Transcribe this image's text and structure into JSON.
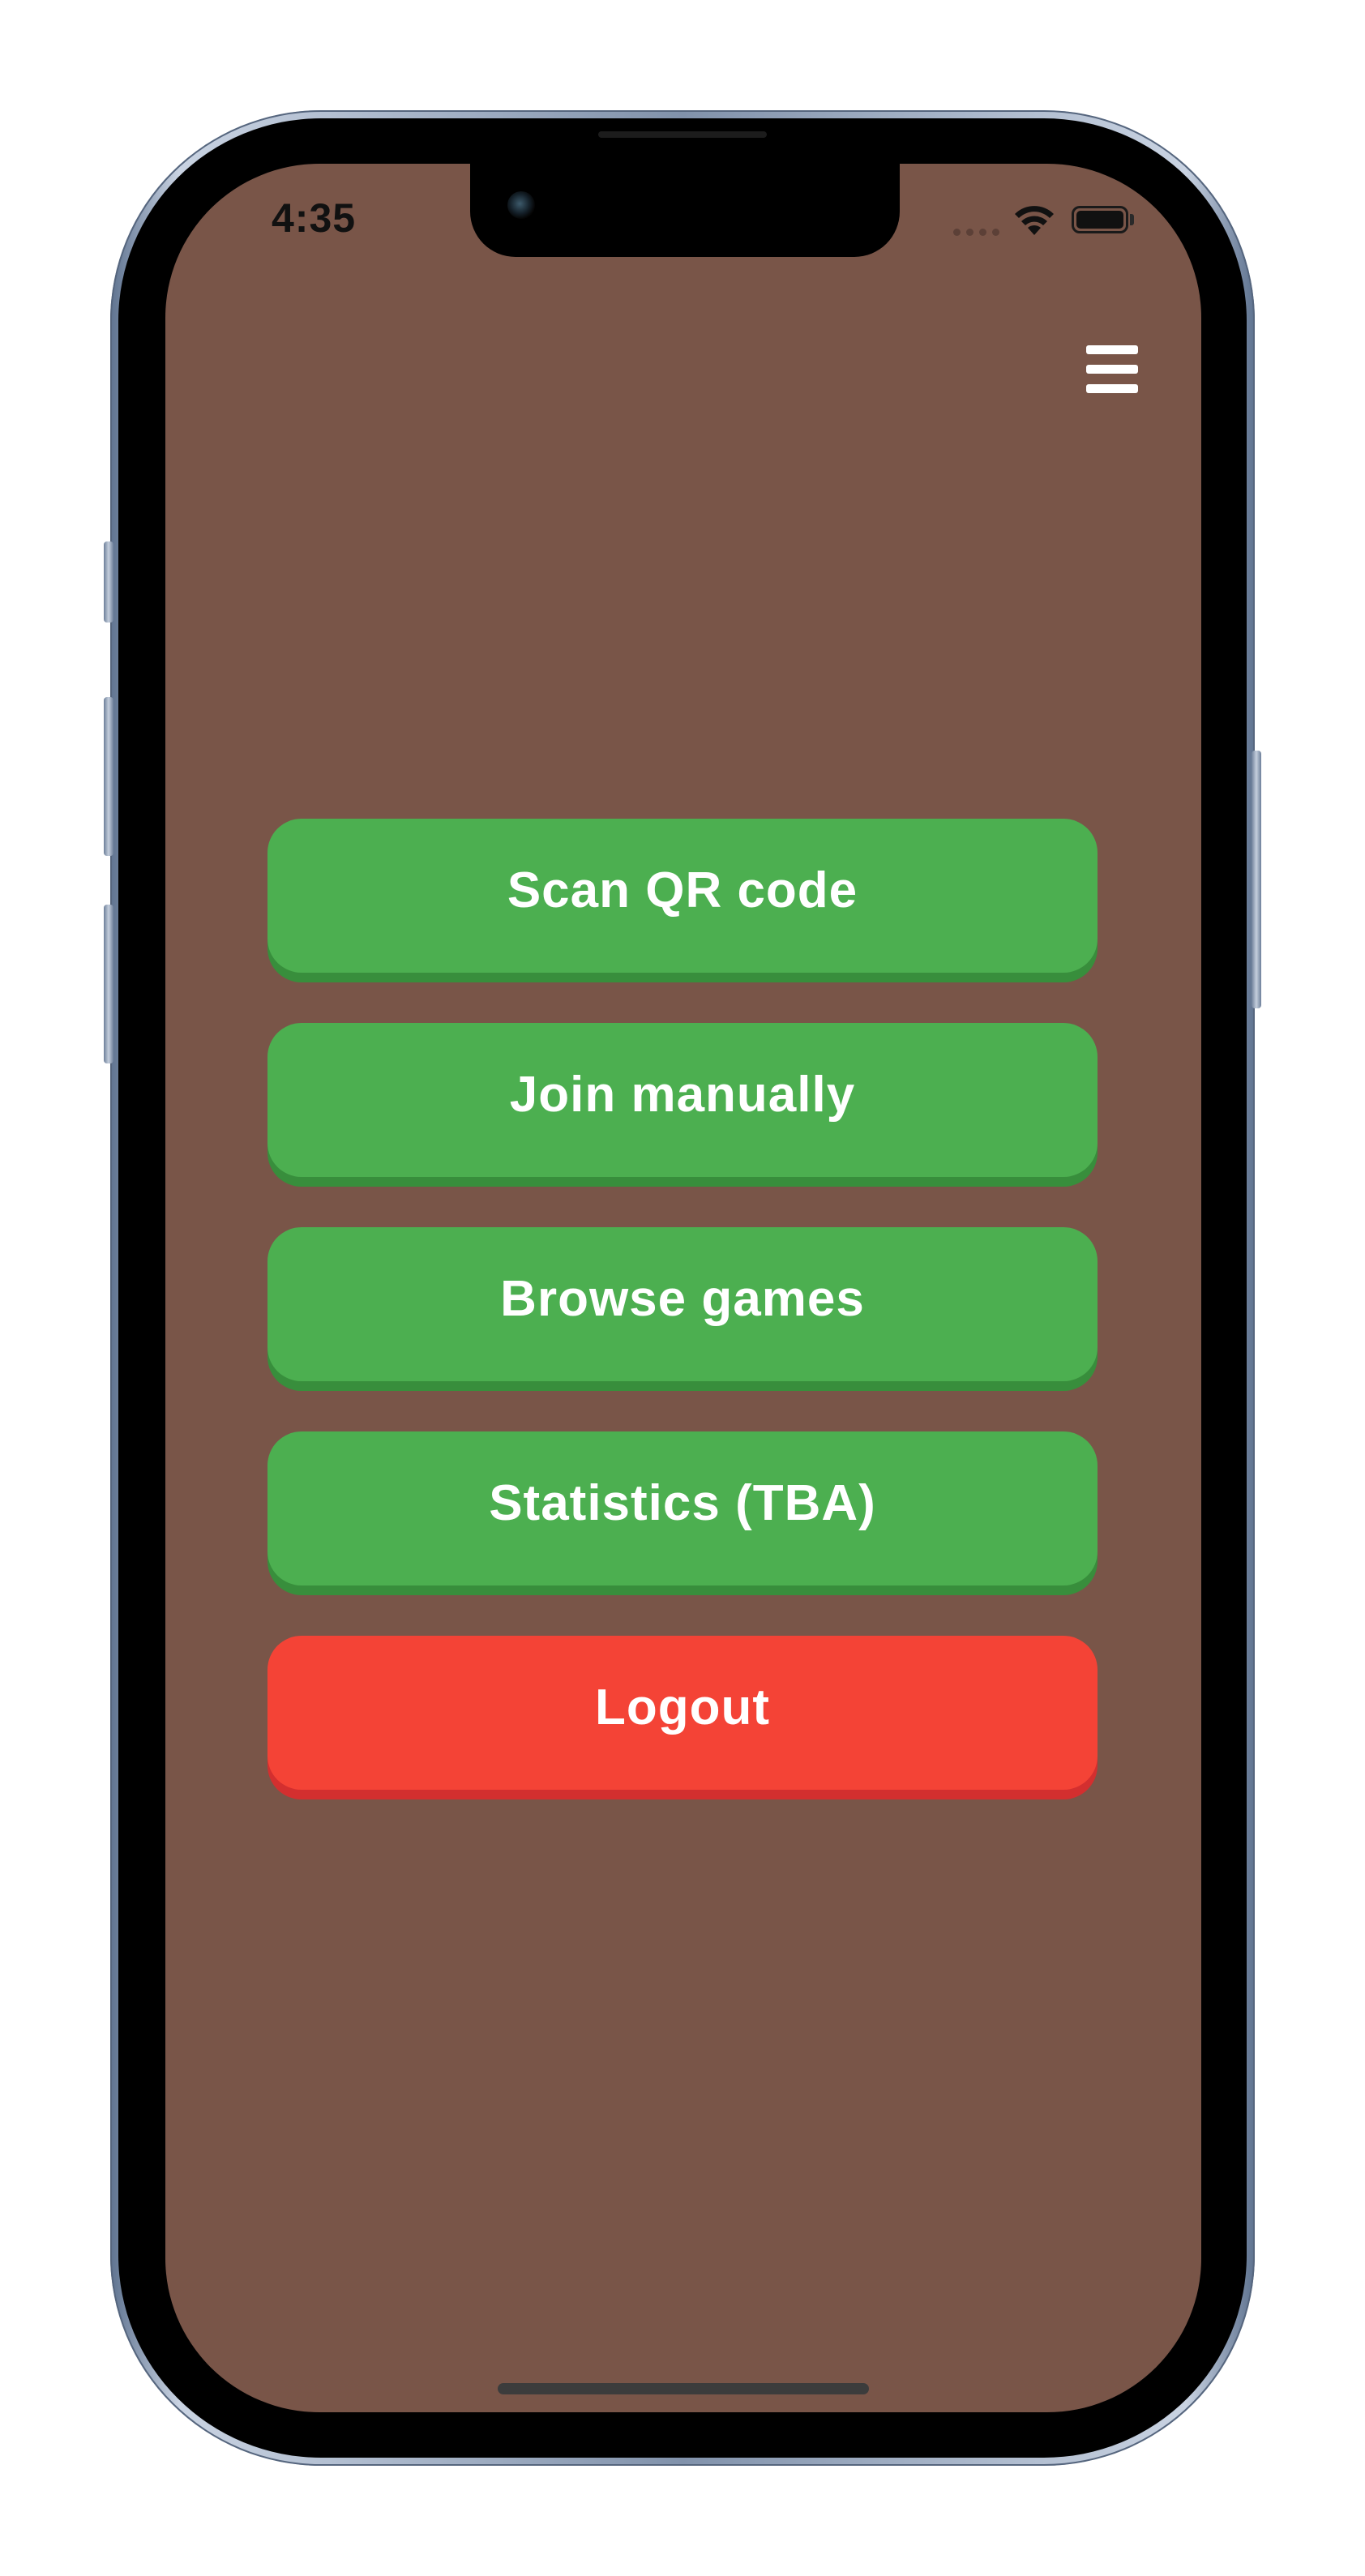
{
  "status_bar": {
    "time": "4:35",
    "wifi_icon": "wifi-icon",
    "battery_icon": "battery-icon",
    "signal_icon": "cellular-signal-icon"
  },
  "header": {
    "menu_icon": "hamburger-menu-icon"
  },
  "menu": {
    "buttons": [
      {
        "label": "Scan QR code",
        "color": "#4caf50"
      },
      {
        "label": "Join manually",
        "color": "#4caf50"
      },
      {
        "label": "Browse games",
        "color": "#4caf50"
      },
      {
        "label": "Statistics (TBA)",
        "color": "#4caf50"
      },
      {
        "label": "Logout",
        "color": "#f44336"
      }
    ]
  },
  "theme": {
    "background": "#795548",
    "primary": "#4caf50",
    "danger": "#f44336"
  }
}
